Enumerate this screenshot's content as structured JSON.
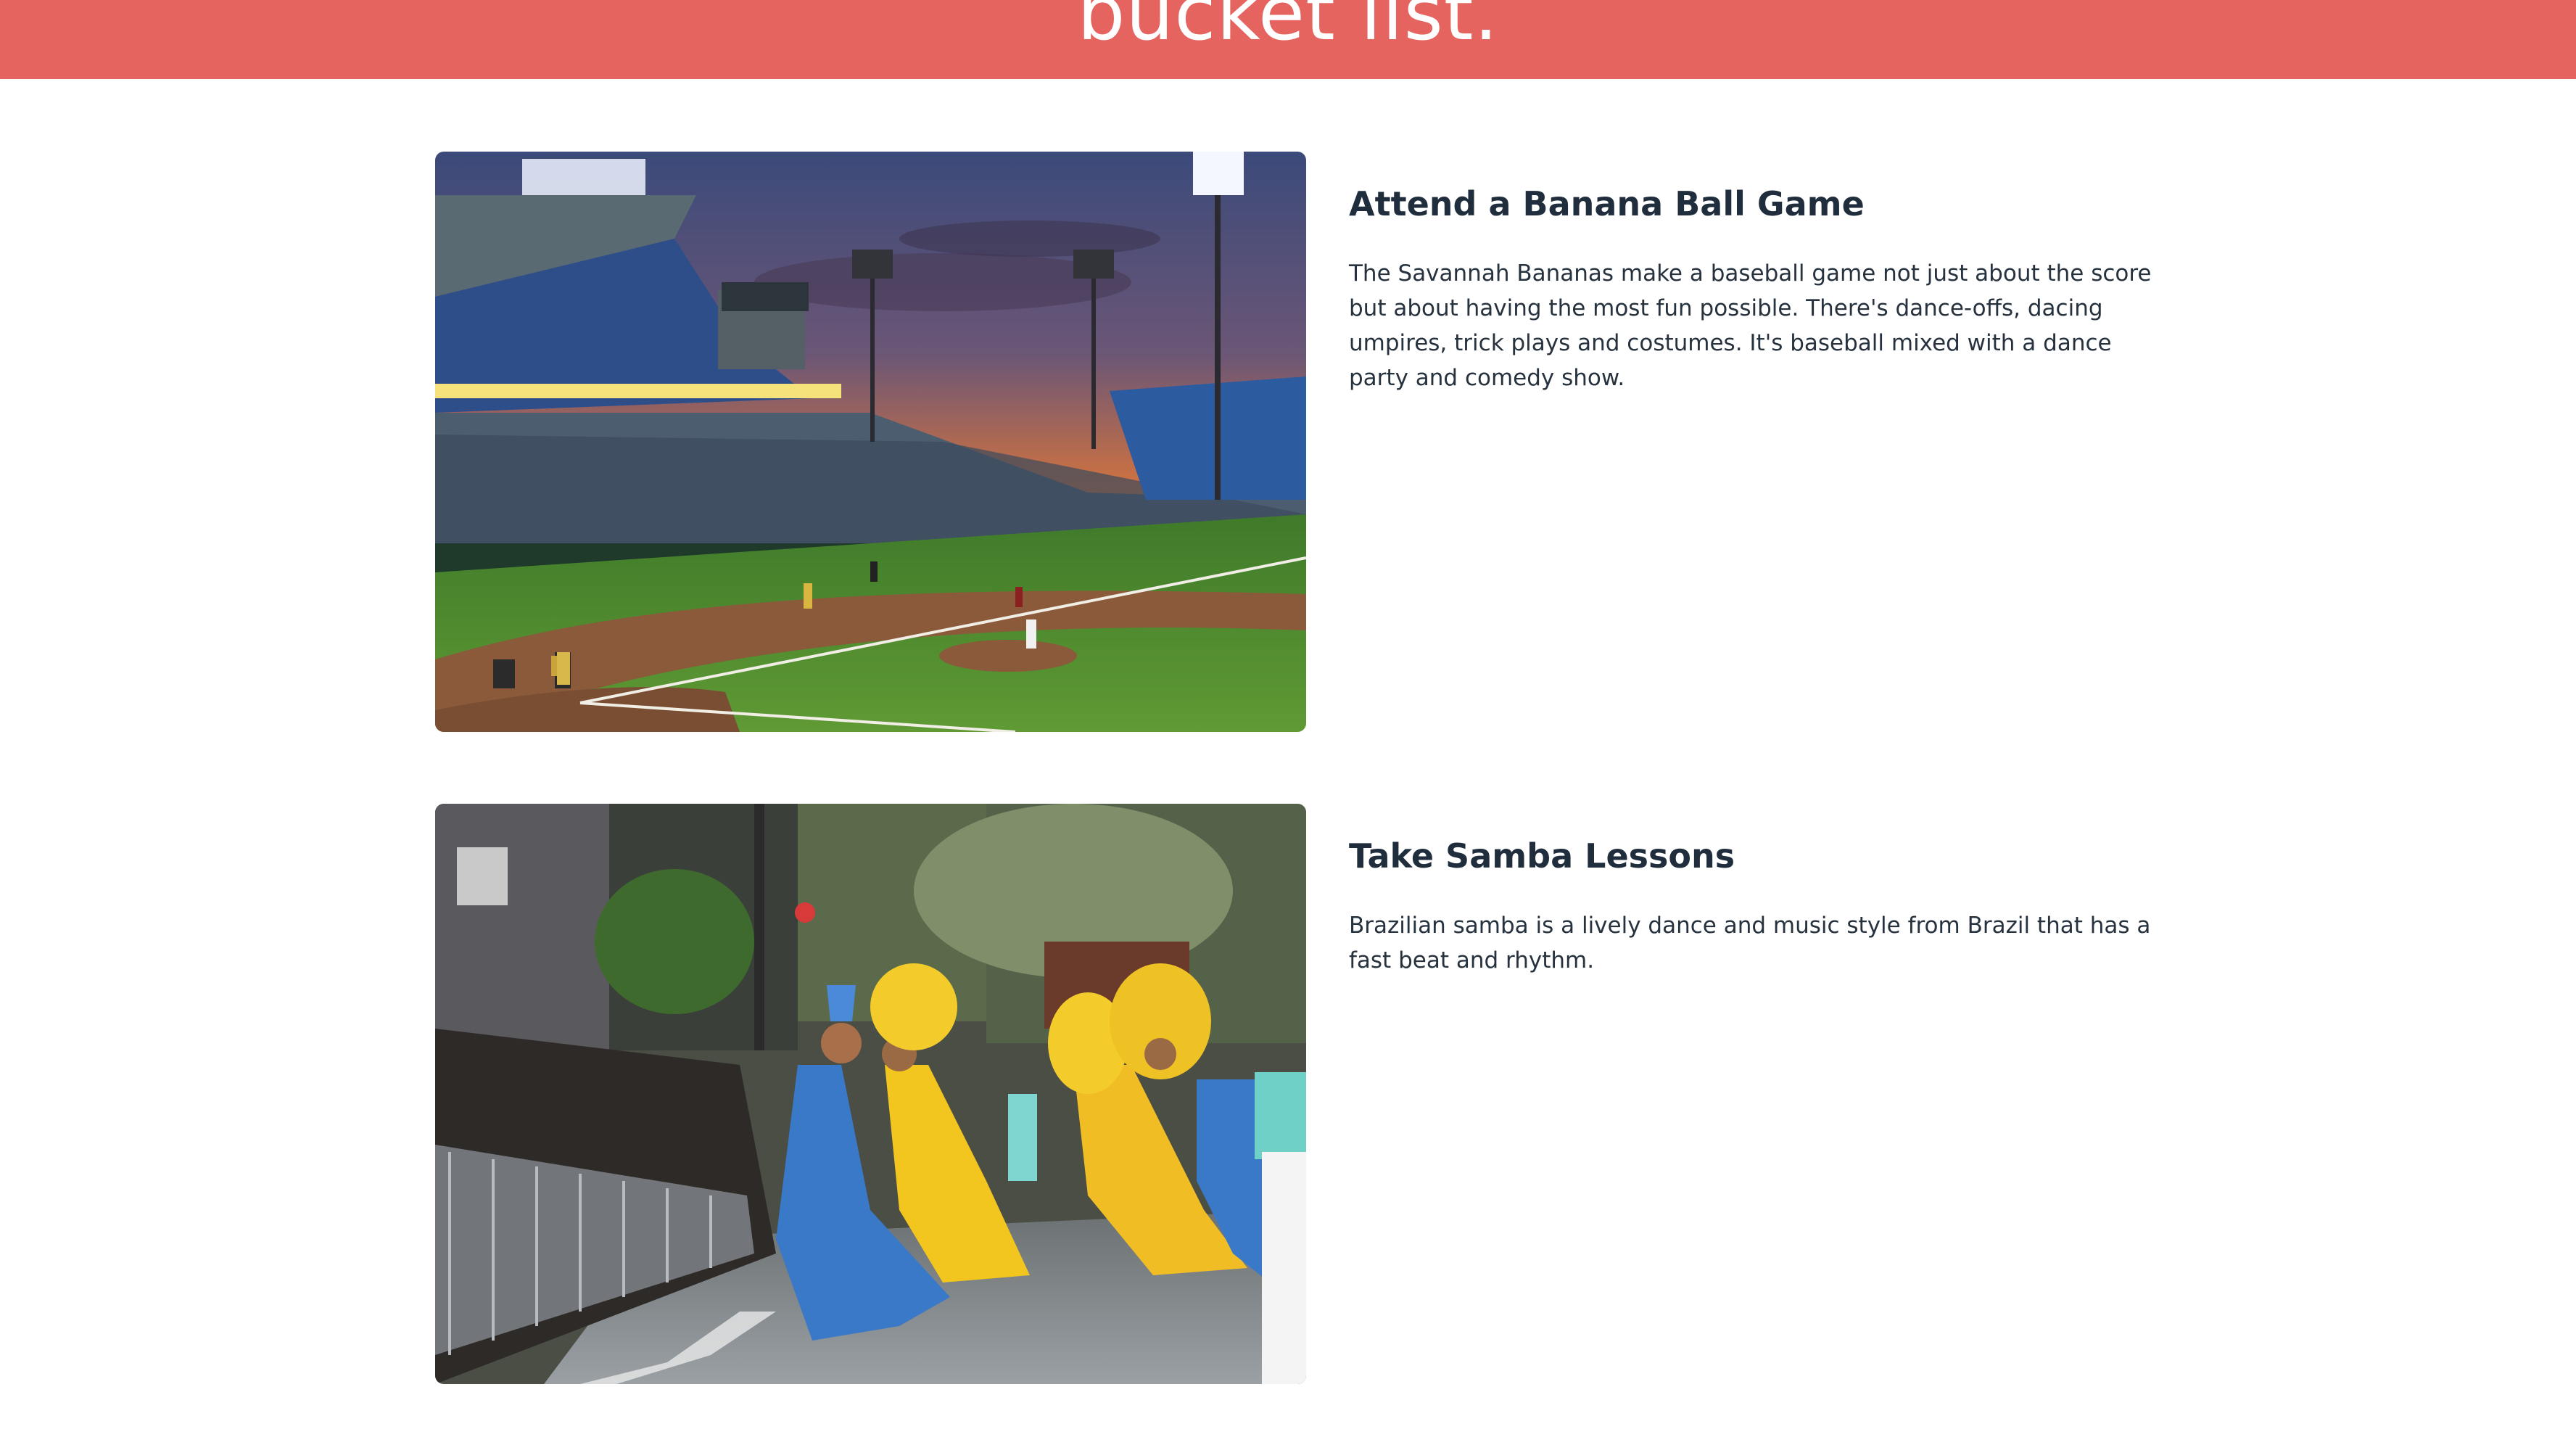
{
  "header": {
    "title": "bucket list.",
    "background_color": "#e5645f"
  },
  "items": [
    {
      "title": "Attend a Banana Ball Game",
      "description": "The Savannah Bananas make a baseball game not just about the score but about having the most fun possible. There's dance-offs, dacing umpires, trick plays and costumes. It's baseball mixed with a dance party and comedy show.",
      "image": "baseball-stadium-photo"
    },
    {
      "title": "Take Samba Lessons",
      "description": "Brazilian samba is a lively dance and music style from Brazil that has a fast beat and rhythm.",
      "image": "samba-parade-photo"
    }
  ]
}
